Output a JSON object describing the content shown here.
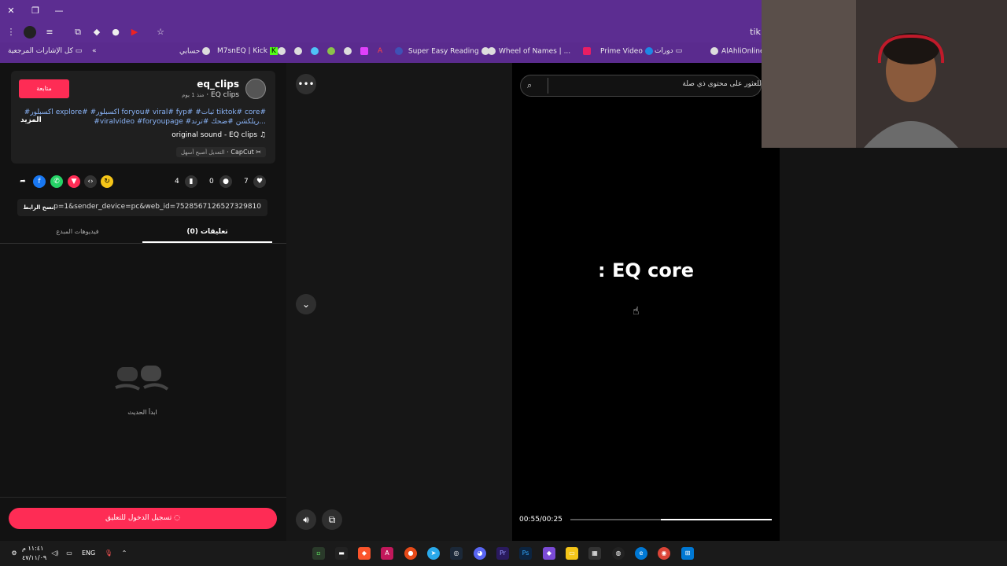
{
  "browser": {
    "tab_fragment": "tik",
    "bookmarks": [
      {
        "label": "كل الإشارات المرجعية"
      },
      {
        "label": "حسابي"
      },
      {
        "label": "M7snEQ | Kick"
      },
      {
        "label": "Super Easy Reading"
      },
      {
        "label": "Wheel of Names | ..."
      },
      {
        "label": "Prime Video"
      },
      {
        "label": "دورات"
      },
      {
        "label": "AlAhliOnline"
      }
    ]
  },
  "post": {
    "follow_label": "متابعة",
    "username": "eq_clips",
    "display_name": "EQ clips",
    "posted_ago": "منذ 1 يوم",
    "more_label": "المزيد",
    "hashtags_line1": "#اكسبلور explore# #اكسبلور foryou# viral# fyp# #ثبات tiktok# core#",
    "hashtags_line2": "#viralvideo #foryoupage #ريلكشن #ضحك #ترند...",
    "sound": "original sound - EQ clips",
    "capcut_label": "CapCut",
    "capcut_desc": "التعديل أصبح أسهل",
    "likes": "7",
    "comments": "0",
    "saves": "4",
    "link": "...p=1&sender_device=pc&web_id=7528567126527329810",
    "copy_link_label": "نسخ الرابط"
  },
  "tabs": {
    "comments": "(0) تعليقات",
    "creator_videos": "فيديوهات المبدع"
  },
  "empty_state": "ابدأ الحديث",
  "login_label": "تسجيل الدخول للتعليق",
  "video": {
    "overlay_text": ": EQ core",
    "timecode": "00:55/00:25",
    "progress": 0.45
  },
  "search": {
    "placeholder": "للعثور على محتوى ذي صلة"
  },
  "taskbar": {
    "time": "١١:٤١ م",
    "date": "٤٧/١١/٠٩",
    "lang": "ENG"
  },
  "colors": {
    "accent": "#fe2c55",
    "chrome": "#5c2d91"
  }
}
